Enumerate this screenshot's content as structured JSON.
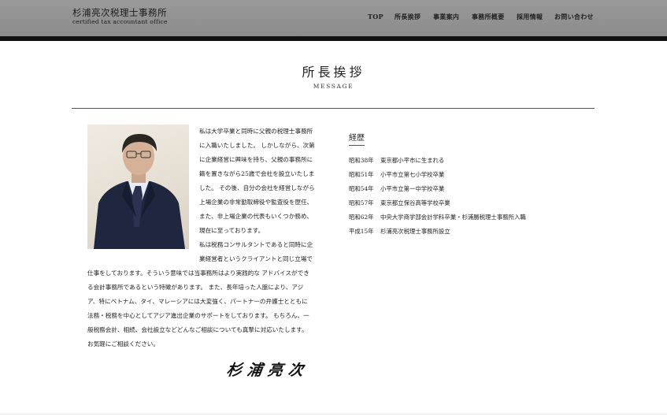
{
  "header": {
    "logo_main": "杉浦亮次税理士事務所",
    "logo_sub": "certified tax accountant office",
    "nav": [
      "TOP",
      "所長挨拶",
      "事業案内",
      "事務所概要",
      "採用情報",
      "お問い合わせ"
    ]
  },
  "page": {
    "title": "所長挨拶",
    "subtitle": "MESSAGE"
  },
  "message": {
    "lines": [
      "私は大学卒業と同時に父親の税理士事務所",
      "に入職いたしました。 しかしながら、次第",
      "に企業経営に興味を持ち、父親の事務所に",
      "籍を置きながら25歳で会社を設立いたしま",
      "した。 その後、自分の会社を経営しながら",
      "上場企業の非常勤取締役や監査役を歴任、",
      "また、非上場企業の代表もいくつか務め、",
      "現在に至っております。",
      "私は税務コンサルタントであると同時に企",
      "業経営者というクライアントと同じ立場で",
      "仕事をしております。そういう意味では当事務所はより実践的な アドバイスができ",
      "る会計事務所であるという特徴があります。 また、長年培った人脈により、アジ",
      "ア、特にベトナム、タイ、マレーシアには大変強く、パートナーの弁護士とともに",
      "法務・税務を中心としてアジア進出企業のサポートをしております。 もちろん、一",
      "般税務会計、相続、会社設立などどんなご相談についても真摯に対応いたします。",
      "お気軽にご相談ください。"
    ],
    "signature": "杉浦亮次"
  },
  "career": {
    "title": "経歴",
    "items": [
      {
        "year": "昭和38年",
        "text": "東京都小平市に生まれる"
      },
      {
        "year": "昭和51年",
        "text": "小平市立第七小学校卒業"
      },
      {
        "year": "昭和54年",
        "text": "小平市立第一中学校卒業"
      },
      {
        "year": "昭和57年",
        "text": "東京都立保谷高等学校卒業"
      },
      {
        "year": "昭和62年",
        "text": "中央大学商学部会計学科卒業・杉浦勝税理士事務所入職"
      },
      {
        "year": "平成15年",
        "text": "杉浦亮次税理士事務所設立"
      }
    ]
  }
}
